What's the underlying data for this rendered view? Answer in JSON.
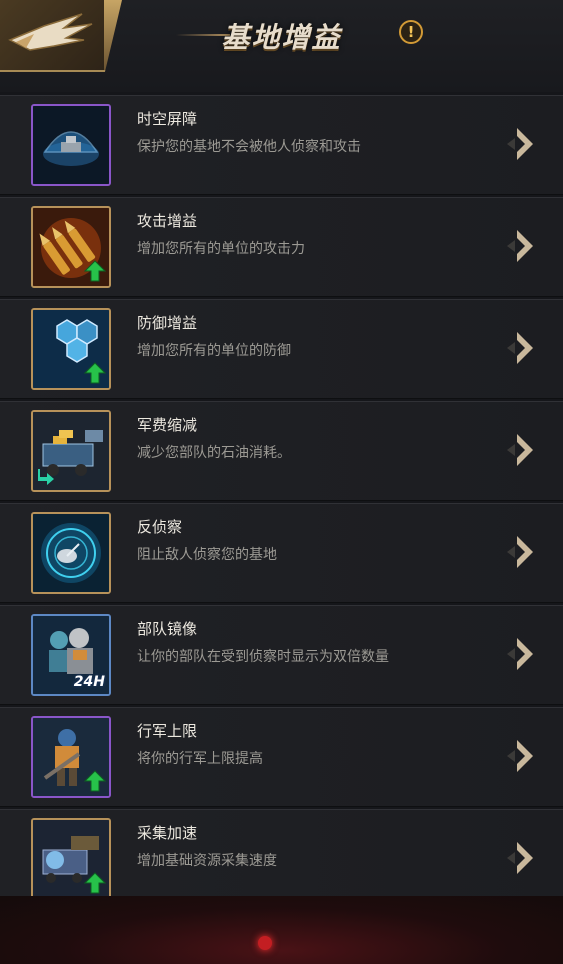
{
  "header": {
    "title": "基地增益",
    "back_icon": "eagle-back-icon",
    "info_icon": "info-icon",
    "info_glyph": "!"
  },
  "colors": {
    "gold_frame": "#b7925a",
    "purple_frame": "#8a56c9",
    "blue_frame": "#5d88c4",
    "boost_green": "#27c24a"
  },
  "items": [
    {
      "title": "时空屏障",
      "desc": "保护您的基地不会被他人侦察和攻击",
      "icon": "dome-shield-icon",
      "frame": "purple",
      "badge": ""
    },
    {
      "title": "攻击增益",
      "desc": "增加您所有的单位的攻击力",
      "icon": "bullets-icon",
      "frame": "gold",
      "badge": "up-arrow"
    },
    {
      "title": "防御增益",
      "desc": "增加您所有的单位的防御",
      "icon": "hex-shield-icon",
      "frame": "gold",
      "badge": "up-arrow"
    },
    {
      "title": "军费缩减",
      "desc": "减少您部队的石油消耗。",
      "icon": "gold-truck-icon",
      "frame": "gold",
      "badge": "down-arrow"
    },
    {
      "title": "反侦察",
      "desc": "阻止敌人侦察您的基地",
      "icon": "radar-dish-icon",
      "frame": "gold",
      "badge": ""
    },
    {
      "title": "部队镜像",
      "desc": "让你的部队在受到侦察时显示为双倍数量",
      "icon": "soldier-mirror-icon",
      "frame": "blue",
      "badge": "24H"
    },
    {
      "title": "行军上限",
      "desc": "将你的行军上限提高",
      "icon": "marching-soldier-icon",
      "frame": "purple",
      "badge": "up-arrow"
    },
    {
      "title": "采集加速",
      "desc": "增加基础资源采集速度",
      "icon": "harvester-icon",
      "frame": "gold",
      "badge": "up-arrow"
    }
  ]
}
